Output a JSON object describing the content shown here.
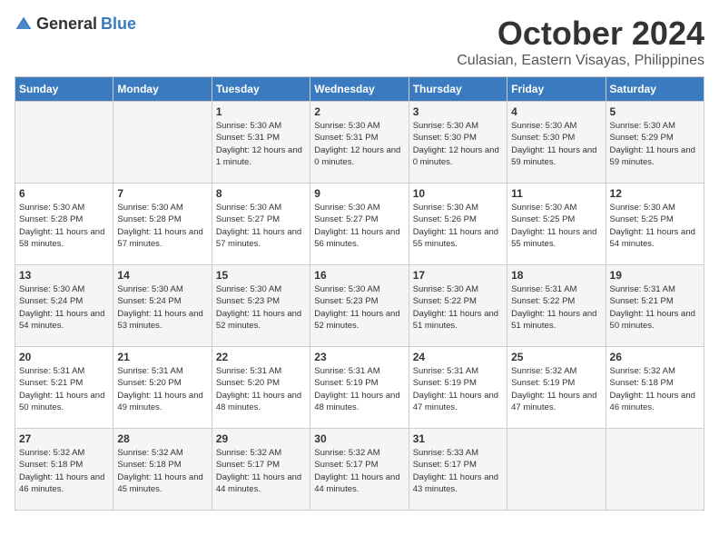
{
  "header": {
    "logo_general": "General",
    "logo_blue": "Blue",
    "month": "October 2024",
    "location": "Culasian, Eastern Visayas, Philippines"
  },
  "days_of_week": [
    "Sunday",
    "Monday",
    "Tuesday",
    "Wednesday",
    "Thursday",
    "Friday",
    "Saturday"
  ],
  "weeks": [
    [
      {
        "day": "",
        "sunrise": "",
        "sunset": "",
        "daylight": ""
      },
      {
        "day": "",
        "sunrise": "",
        "sunset": "",
        "daylight": ""
      },
      {
        "day": "1",
        "sunrise": "Sunrise: 5:30 AM",
        "sunset": "Sunset: 5:31 PM",
        "daylight": "Daylight: 12 hours and 1 minute."
      },
      {
        "day": "2",
        "sunrise": "Sunrise: 5:30 AM",
        "sunset": "Sunset: 5:31 PM",
        "daylight": "Daylight: 12 hours and 0 minutes."
      },
      {
        "day": "3",
        "sunrise": "Sunrise: 5:30 AM",
        "sunset": "Sunset: 5:30 PM",
        "daylight": "Daylight: 12 hours and 0 minutes."
      },
      {
        "day": "4",
        "sunrise": "Sunrise: 5:30 AM",
        "sunset": "Sunset: 5:30 PM",
        "daylight": "Daylight: 11 hours and 59 minutes."
      },
      {
        "day": "5",
        "sunrise": "Sunrise: 5:30 AM",
        "sunset": "Sunset: 5:29 PM",
        "daylight": "Daylight: 11 hours and 59 minutes."
      }
    ],
    [
      {
        "day": "6",
        "sunrise": "Sunrise: 5:30 AM",
        "sunset": "Sunset: 5:28 PM",
        "daylight": "Daylight: 11 hours and 58 minutes."
      },
      {
        "day": "7",
        "sunrise": "Sunrise: 5:30 AM",
        "sunset": "Sunset: 5:28 PM",
        "daylight": "Daylight: 11 hours and 57 minutes."
      },
      {
        "day": "8",
        "sunrise": "Sunrise: 5:30 AM",
        "sunset": "Sunset: 5:27 PM",
        "daylight": "Daylight: 11 hours and 57 minutes."
      },
      {
        "day": "9",
        "sunrise": "Sunrise: 5:30 AM",
        "sunset": "Sunset: 5:27 PM",
        "daylight": "Daylight: 11 hours and 56 minutes."
      },
      {
        "day": "10",
        "sunrise": "Sunrise: 5:30 AM",
        "sunset": "Sunset: 5:26 PM",
        "daylight": "Daylight: 11 hours and 55 minutes."
      },
      {
        "day": "11",
        "sunrise": "Sunrise: 5:30 AM",
        "sunset": "Sunset: 5:25 PM",
        "daylight": "Daylight: 11 hours and 55 minutes."
      },
      {
        "day": "12",
        "sunrise": "Sunrise: 5:30 AM",
        "sunset": "Sunset: 5:25 PM",
        "daylight": "Daylight: 11 hours and 54 minutes."
      }
    ],
    [
      {
        "day": "13",
        "sunrise": "Sunrise: 5:30 AM",
        "sunset": "Sunset: 5:24 PM",
        "daylight": "Daylight: 11 hours and 54 minutes."
      },
      {
        "day": "14",
        "sunrise": "Sunrise: 5:30 AM",
        "sunset": "Sunset: 5:24 PM",
        "daylight": "Daylight: 11 hours and 53 minutes."
      },
      {
        "day": "15",
        "sunrise": "Sunrise: 5:30 AM",
        "sunset": "Sunset: 5:23 PM",
        "daylight": "Daylight: 11 hours and 52 minutes."
      },
      {
        "day": "16",
        "sunrise": "Sunrise: 5:30 AM",
        "sunset": "Sunset: 5:23 PM",
        "daylight": "Daylight: 11 hours and 52 minutes."
      },
      {
        "day": "17",
        "sunrise": "Sunrise: 5:30 AM",
        "sunset": "Sunset: 5:22 PM",
        "daylight": "Daylight: 11 hours and 51 minutes."
      },
      {
        "day": "18",
        "sunrise": "Sunrise: 5:31 AM",
        "sunset": "Sunset: 5:22 PM",
        "daylight": "Daylight: 11 hours and 51 minutes."
      },
      {
        "day": "19",
        "sunrise": "Sunrise: 5:31 AM",
        "sunset": "Sunset: 5:21 PM",
        "daylight": "Daylight: 11 hours and 50 minutes."
      }
    ],
    [
      {
        "day": "20",
        "sunrise": "Sunrise: 5:31 AM",
        "sunset": "Sunset: 5:21 PM",
        "daylight": "Daylight: 11 hours and 50 minutes."
      },
      {
        "day": "21",
        "sunrise": "Sunrise: 5:31 AM",
        "sunset": "Sunset: 5:20 PM",
        "daylight": "Daylight: 11 hours and 49 minutes."
      },
      {
        "day": "22",
        "sunrise": "Sunrise: 5:31 AM",
        "sunset": "Sunset: 5:20 PM",
        "daylight": "Daylight: 11 hours and 48 minutes."
      },
      {
        "day": "23",
        "sunrise": "Sunrise: 5:31 AM",
        "sunset": "Sunset: 5:19 PM",
        "daylight": "Daylight: 11 hours and 48 minutes."
      },
      {
        "day": "24",
        "sunrise": "Sunrise: 5:31 AM",
        "sunset": "Sunset: 5:19 PM",
        "daylight": "Daylight: 11 hours and 47 minutes."
      },
      {
        "day": "25",
        "sunrise": "Sunrise: 5:32 AM",
        "sunset": "Sunset: 5:19 PM",
        "daylight": "Daylight: 11 hours and 47 minutes."
      },
      {
        "day": "26",
        "sunrise": "Sunrise: 5:32 AM",
        "sunset": "Sunset: 5:18 PM",
        "daylight": "Daylight: 11 hours and 46 minutes."
      }
    ],
    [
      {
        "day": "27",
        "sunrise": "Sunrise: 5:32 AM",
        "sunset": "Sunset: 5:18 PM",
        "daylight": "Daylight: 11 hours and 46 minutes."
      },
      {
        "day": "28",
        "sunrise": "Sunrise: 5:32 AM",
        "sunset": "Sunset: 5:18 PM",
        "daylight": "Daylight: 11 hours and 45 minutes."
      },
      {
        "day": "29",
        "sunrise": "Sunrise: 5:32 AM",
        "sunset": "Sunset: 5:17 PM",
        "daylight": "Daylight: 11 hours and 44 minutes."
      },
      {
        "day": "30",
        "sunrise": "Sunrise: 5:32 AM",
        "sunset": "Sunset: 5:17 PM",
        "daylight": "Daylight: 11 hours and 44 minutes."
      },
      {
        "day": "31",
        "sunrise": "Sunrise: 5:33 AM",
        "sunset": "Sunset: 5:17 PM",
        "daylight": "Daylight: 11 hours and 43 minutes."
      },
      {
        "day": "",
        "sunrise": "",
        "sunset": "",
        "daylight": ""
      },
      {
        "day": "",
        "sunrise": "",
        "sunset": "",
        "daylight": ""
      }
    ]
  ]
}
